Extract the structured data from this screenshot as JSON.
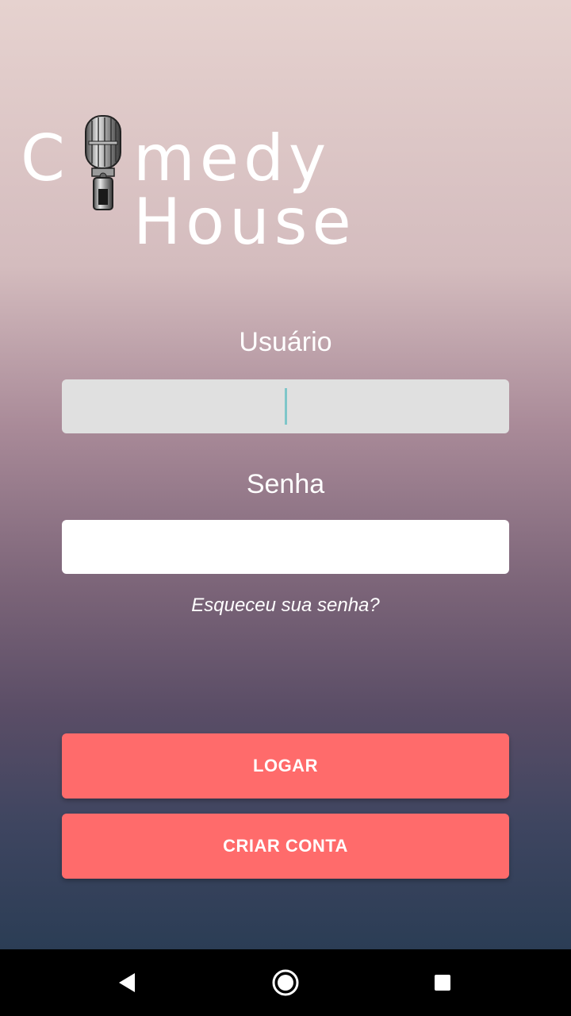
{
  "logo": {
    "first_letter": "C",
    "rest": "medy House",
    "icon": "microphone-icon"
  },
  "form": {
    "user_label": "Usuário",
    "user_value": "",
    "password_label": "Senha",
    "password_value": "",
    "forgot_link": "Esqueceu sua senha?"
  },
  "buttons": {
    "login": "LOGAR",
    "create_account": "CRIAR CONTA"
  },
  "nav": {
    "back_icon": "back-triangle-icon",
    "home_icon": "home-circle-icon",
    "recent_icon": "recent-square-icon"
  },
  "colors": {
    "button": "#ff6b6b",
    "caret": "#7fc6c9",
    "user_input_bg": "#e0e0e0",
    "password_input_bg": "#ffffff"
  }
}
